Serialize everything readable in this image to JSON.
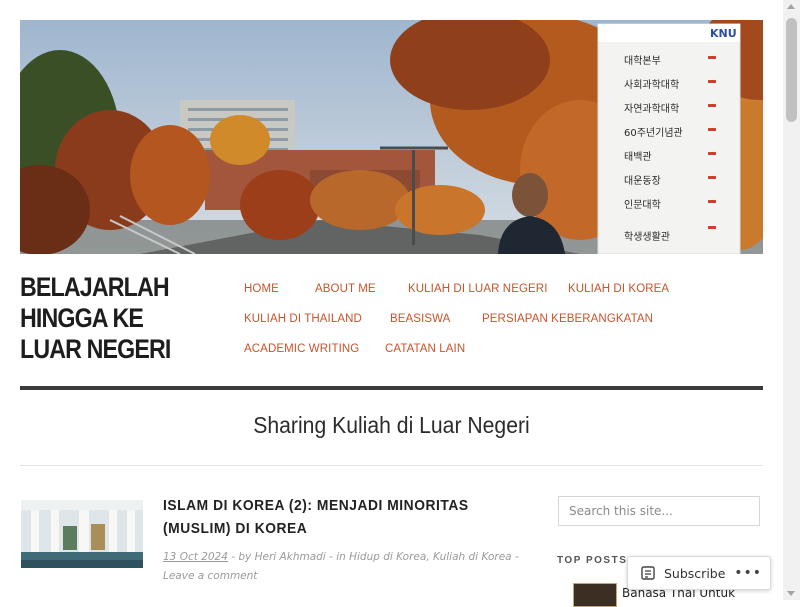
{
  "site": {
    "title": "BELAJARLAH HINGGA KE LUAR NEGERI"
  },
  "hero": {
    "sign_brand": "KNU",
    "sign_items": [
      "대학본부",
      "사회과학대학",
      "자연과학대학",
      "60주년기념관",
      "태백관",
      "대운동장",
      "인문대학",
      "학생생활관"
    ]
  },
  "nav": {
    "items": [
      {
        "label": "HOME"
      },
      {
        "label": "ABOUT ME"
      },
      {
        "label": "KULIAH DI LUAR NEGERI"
      },
      {
        "label": "KULIAH DI KOREA"
      },
      {
        "label": "KULIAH DI THAILAND"
      },
      {
        "label": "BEASISWA"
      },
      {
        "label": "PERSIAPAN KEBERANGKATAN"
      },
      {
        "label": "ACADEMIC WRITING"
      },
      {
        "label": "CATATAN LAIN"
      }
    ]
  },
  "main": {
    "section_title": "Sharing Kuliah di Luar Negeri",
    "post": {
      "title": "ISLAM DI KOREA (2): MENJADI MINORITAS (MUSLIM) DI KOREA",
      "date": "13 Oct 2024",
      "by": "- by",
      "author": "Heri Akhmadi",
      "in": "- in",
      "category_1": "Hidup di Korea",
      "sep": ",",
      "category_2": "Kuliah di Korea",
      "dash": "-",
      "comment": "Leave a comment"
    }
  },
  "sidebar": {
    "search_placeholder": "Search this site...",
    "widget_title": "TOP POSTS &",
    "top_post_1": "Bahasa Thai Untuk"
  },
  "subscribe": {
    "label": "Subscribe",
    "more": "•••"
  },
  "colors": {
    "accent": "#c7542b",
    "rule": "#3b3b3b"
  }
}
